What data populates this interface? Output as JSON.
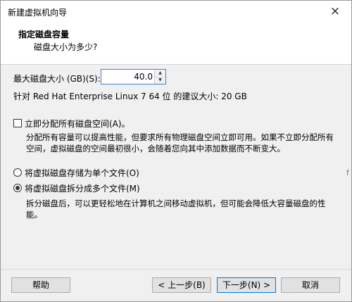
{
  "window": {
    "title": "新建虚拟机向导",
    "close_icon": "×"
  },
  "header": {
    "title": "指定磁盘容量",
    "subtitle": "磁盘大小为多少?"
  },
  "disk_size": {
    "label": "最大磁盘大小 (GB)(S):",
    "value": "40.0",
    "spin_up": "▲",
    "spin_down": "▼"
  },
  "recommendation": "针对 Red Hat Enterprise Linux 7 64 位 的建议大小: 20 GB",
  "allocate": {
    "label": "立即分配所有磁盘空间(A)。",
    "checked": false,
    "desc_line1": "分配所有容量可以提高性能，但要求所有物理磁盘空间立即可用。如果不立即分配所有",
    "desc_line2": "空间，虚拟磁盘的空间最初很小，会随着您向其中添加数据而不断变大。"
  },
  "storage": {
    "single_file_label": "将虚拟磁盘存储为单个文件(O)",
    "split_files_label": "将虚拟磁盘拆分成多个文件(M)",
    "selected": "split",
    "desc_line1": "拆分磁盘后，可以更轻松地在计算机之间移动虚拟机，但可能会降低大容量磁盘的性",
    "desc_line2": "能。"
  },
  "buttons": {
    "help": "帮助",
    "back": "< 上一步(B)",
    "next": "下一步(N) >",
    "cancel": "取消"
  },
  "stray_char": "f"
}
